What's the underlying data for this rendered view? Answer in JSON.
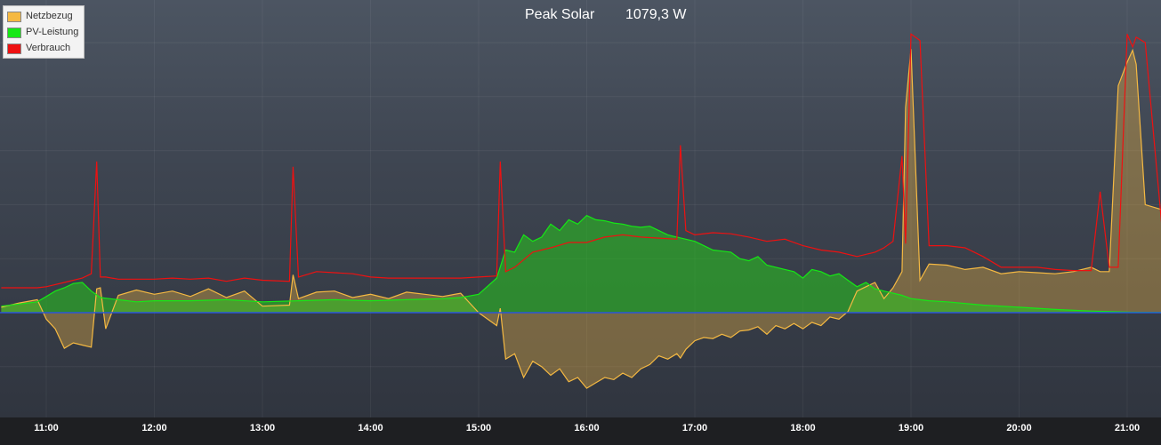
{
  "header": {
    "peak_label": "Peak Solar",
    "peak_value": "1079,3 W"
  },
  "legend": [
    {
      "label": "Netzbezug",
      "color": "#f5b942"
    },
    {
      "label": "PV-Leistung",
      "color": "#15e815"
    },
    {
      "label": "Verbrauch",
      "color": "#ee1111"
    }
  ],
  "chart_data": {
    "type": "area",
    "x_ticks": [
      "11:00",
      "12:00",
      "13:00",
      "14:00",
      "15:00",
      "16:00",
      "17:00",
      "18:00",
      "19:00",
      "20:00",
      "21:00"
    ],
    "x_range": [
      "10:35",
      "21:30"
    ],
    "y_range": [
      -1000,
      2800
    ],
    "grid": true,
    "legend_position": "top-left",
    "series": [
      {
        "name": "Netzbezug",
        "color": "#f5b942",
        "x": [
          "10:35",
          "10:45",
          "10:55",
          "11:00",
          "11:05",
          "11:10",
          "11:15",
          "11:20",
          "11:25",
          "11:28",
          "11:30",
          "11:33",
          "11:40",
          "11:50",
          "12:00",
          "12:10",
          "12:20",
          "12:30",
          "12:40",
          "12:50",
          "13:00",
          "13:15",
          "13:17",
          "13:20",
          "13:30",
          "13:40",
          "13:50",
          "14:00",
          "14:10",
          "14:20",
          "14:30",
          "14:40",
          "14:50",
          "15:00",
          "15:10",
          "15:12",
          "15:15",
          "15:20",
          "15:25",
          "15:30",
          "15:35",
          "15:40",
          "15:45",
          "15:50",
          "15:55",
          "16:00",
          "16:05",
          "16:10",
          "16:15",
          "16:20",
          "16:25",
          "16:30",
          "16:35",
          "16:40",
          "16:45",
          "16:50",
          "16:52",
          "16:55",
          "17:00",
          "17:05",
          "17:10",
          "17:15",
          "17:20",
          "17:25",
          "17:30",
          "17:35",
          "17:40",
          "17:45",
          "17:50",
          "17:55",
          "18:00",
          "18:05",
          "18:10",
          "18:15",
          "18:20",
          "18:25",
          "18:30",
          "18:35",
          "18:40",
          "18:45",
          "18:50",
          "18:55",
          "18:57",
          "19:00",
          "19:05",
          "19:10",
          "19:20",
          "19:30",
          "19:40",
          "19:50",
          "20:00",
          "20:10",
          "20:20",
          "20:30",
          "20:40",
          "20:45",
          "20:50",
          "20:55",
          "21:00",
          "21:03",
          "21:05",
          "21:10",
          "21:20",
          "21:30"
        ],
        "values": [
          50,
          90,
          120,
          -60,
          -150,
          -330,
          -280,
          -300,
          -320,
          220,
          230,
          -150,
          160,
          210,
          170,
          200,
          150,
          220,
          140,
          200,
          60,
          70,
          350,
          130,
          190,
          200,
          140,
          170,
          130,
          190,
          170,
          150,
          180,
          0,
          -120,
          40,
          -430,
          -380,
          -600,
          -450,
          -500,
          -580,
          -520,
          -640,
          -600,
          -700,
          -650,
          -600,
          -620,
          -560,
          -600,
          -520,
          -480,
          -400,
          -430,
          -380,
          -420,
          -340,
          -260,
          -230,
          -240,
          -200,
          -230,
          -170,
          -160,
          -130,
          -200,
          -120,
          -150,
          -100,
          -150,
          -90,
          -120,
          -40,
          -60,
          10,
          200,
          240,
          280,
          130,
          230,
          380,
          1900,
          2440,
          300,
          450,
          440,
          400,
          420,
          360,
          380,
          370,
          360,
          380,
          420,
          380,
          380,
          2100,
          2320,
          2430,
          2300,
          1000,
          950,
          940
        ]
      },
      {
        "name": "PV-Leistung",
        "color": "#15e815",
        "x": [
          "10:35",
          "10:45",
          "10:55",
          "11:00",
          "11:05",
          "11:10",
          "11:15",
          "11:20",
          "11:25",
          "11:30",
          "11:40",
          "11:50",
          "12:00",
          "12:20",
          "12:40",
          "13:00",
          "13:20",
          "13:40",
          "14:00",
          "14:20",
          "14:40",
          "14:50",
          "15:00",
          "15:10",
          "15:15",
          "15:20",
          "15:25",
          "15:30",
          "15:35",
          "15:40",
          "15:45",
          "15:50",
          "15:55",
          "16:00",
          "16:05",
          "16:10",
          "16:15",
          "16:20",
          "16:25",
          "16:30",
          "16:35",
          "16:40",
          "16:45",
          "16:50",
          "16:55",
          "17:00",
          "17:05",
          "17:10",
          "17:15",
          "17:20",
          "17:25",
          "17:30",
          "17:35",
          "17:40",
          "17:45",
          "17:50",
          "17:55",
          "18:00",
          "18:05",
          "18:10",
          "18:15",
          "18:20",
          "18:25",
          "18:30",
          "18:35",
          "18:40",
          "18:45",
          "18:50",
          "18:55",
          "19:00",
          "19:10",
          "19:20",
          "19:40",
          "20:00",
          "20:20",
          "20:40",
          "21:00",
          "21:20",
          "21:30"
        ],
        "values": [
          60,
          80,
          100,
          150,
          200,
          230,
          270,
          280,
          200,
          140,
          120,
          100,
          110,
          110,
          120,
          100,
          110,
          120,
          110,
          120,
          130,
          140,
          170,
          320,
          580,
          560,
          720,
          660,
          700,
          820,
          760,
          860,
          820,
          900,
          860,
          850,
          830,
          820,
          800,
          790,
          800,
          760,
          720,
          700,
          680,
          660,
          620,
          580,
          570,
          560,
          500,
          480,
          520,
          440,
          420,
          400,
          380,
          320,
          400,
          380,
          340,
          360,
          300,
          240,
          280,
          220,
          200,
          180,
          160,
          130,
          110,
          100,
          70,
          50,
          30,
          15,
          5,
          2,
          0
        ]
      },
      {
        "name": "Verbrauch",
        "color": "#ee1111",
        "x": [
          "10:35",
          "10:45",
          "10:55",
          "11:00",
          "11:10",
          "11:20",
          "11:25",
          "11:28",
          "11:30",
          "11:33",
          "11:40",
          "12:00",
          "12:10",
          "12:20",
          "12:30",
          "12:40",
          "12:50",
          "13:00",
          "13:15",
          "13:17",
          "13:20",
          "13:30",
          "13:40",
          "13:50",
          "14:00",
          "14:10",
          "14:20",
          "14:30",
          "14:40",
          "14:50",
          "15:00",
          "15:10",
          "15:12",
          "15:15",
          "15:20",
          "15:30",
          "15:40",
          "15:50",
          "16:00",
          "16:10",
          "16:20",
          "16:30",
          "16:40",
          "16:50",
          "16:52",
          "16:55",
          "17:00",
          "17:10",
          "17:20",
          "17:30",
          "17:40",
          "17:50",
          "18:00",
          "18:10",
          "18:20",
          "18:30",
          "18:40",
          "18:45",
          "18:50",
          "18:55",
          "18:57",
          "19:00",
          "19:05",
          "19:10",
          "19:20",
          "19:30",
          "19:40",
          "19:50",
          "20:00",
          "20:10",
          "20:20",
          "20:30",
          "20:40",
          "20:45",
          "20:50",
          "20:55",
          "21:00",
          "21:03",
          "21:05",
          "21:10",
          "21:20",
          "21:30"
        ],
        "values": [
          230,
          230,
          230,
          240,
          280,
          320,
          360,
          1400,
          330,
          330,
          310,
          310,
          320,
          310,
          320,
          290,
          320,
          300,
          290,
          1350,
          330,
          380,
          370,
          360,
          330,
          320,
          320,
          320,
          320,
          320,
          330,
          340,
          1400,
          380,
          420,
          560,
          600,
          650,
          650,
          700,
          720,
          700,
          690,
          680,
          1550,
          760,
          720,
          740,
          730,
          700,
          660,
          680,
          620,
          580,
          560,
          520,
          560,
          600,
          660,
          1450,
          640,
          2580,
          2520,
          620,
          620,
          600,
          520,
          420,
          420,
          420,
          400,
          390,
          390,
          1120,
          420,
          420,
          2580,
          2460,
          2550,
          2500,
          660,
          660
        ]
      }
    ]
  }
}
